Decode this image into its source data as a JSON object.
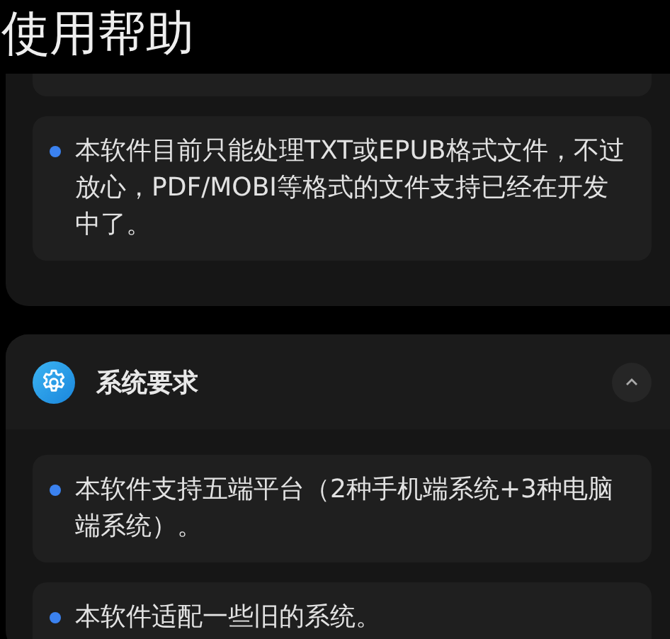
{
  "title": "使用帮助",
  "sections": [
    {
      "items": [
        {
          "kind": "clipped"
        },
        {
          "kind": "bullet",
          "text": "本软件目前只能处理TXT或EPUB格式文件，不过放心，PDF/MOBI等格式的文件支持已经在开发中了。"
        }
      ]
    },
    {
      "title": "系统要求",
      "expanded": true,
      "items": [
        {
          "kind": "bullet",
          "text": "本软件支持五端平台（2种手机端系统+3种电脑端系统）。"
        },
        {
          "kind": "bullet",
          "text": "本软件适配一些旧的系统。"
        }
      ]
    }
  ]
}
